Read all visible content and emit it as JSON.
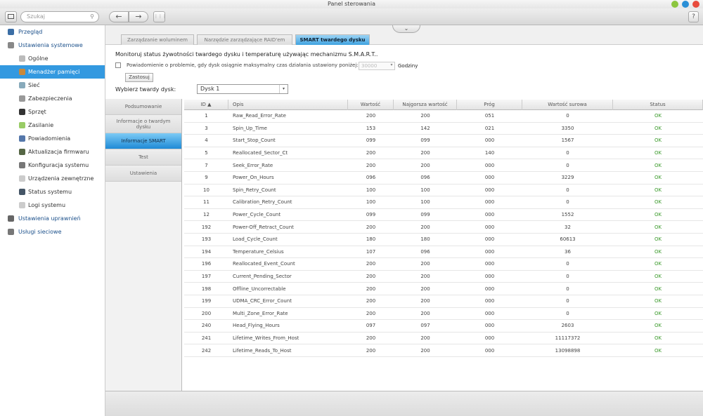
{
  "window": {
    "title": "Panel sterowania",
    "colors": {
      "minimize": "#8cc63f",
      "maximize": "#2a8fd6",
      "close": "#e84c3d"
    }
  },
  "toolbar": {
    "search_placeholder": "Szukaj",
    "back_icon": "←",
    "forward_icon": "→",
    "apps_icon": "⋮⋮⋮",
    "help_label": "?",
    "search_icon": "⚲"
  },
  "sidebar": {
    "items": [
      {
        "label": "Przegląd",
        "level": "top",
        "color": "#3b6ea5"
      },
      {
        "label": "Ustawienia systemowe",
        "level": "top",
        "color": "#888"
      },
      {
        "label": "Ogólne",
        "level": "sub",
        "color": "#bbb"
      },
      {
        "label": "Menadżer pamięci",
        "level": "sub",
        "active": true,
        "color": "#c8883a"
      },
      {
        "label": "Sieć",
        "level": "sub",
        "color": "#8ab"
      },
      {
        "label": "Zabezpieczenia",
        "level": "sub",
        "color": "#999"
      },
      {
        "label": "Sprzęt",
        "level": "sub",
        "color": "#333"
      },
      {
        "label": "Zasilanie",
        "level": "sub",
        "color": "#9c6"
      },
      {
        "label": "Powiadomienia",
        "level": "sub",
        "color": "#57a"
      },
      {
        "label": "Aktualizacja firmwaru",
        "level": "sub",
        "color": "#564"
      },
      {
        "label": "Konfiguracja systemu",
        "level": "sub",
        "color": "#777"
      },
      {
        "label": "Urządzenia zewnętrzne",
        "level": "sub",
        "color": "#ccc"
      },
      {
        "label": "Status systemu",
        "level": "sub",
        "color": "#456"
      },
      {
        "label": "Logi systemu",
        "level": "sub",
        "color": "#ccc"
      },
      {
        "label": "Ustawienia uprawnień",
        "level": "top",
        "color": "#666"
      },
      {
        "label": "Usługi sieciowe",
        "level": "top",
        "color": "#777"
      }
    ]
  },
  "tabs": [
    {
      "label": "Zarządzanie woluminem"
    },
    {
      "label": "Narzędzie zarządzające RAID'em"
    },
    {
      "label": "SMART twardego dysku",
      "active": true
    }
  ],
  "collapse_icon": "⌄",
  "main": {
    "description": "Monitoruj status żywotności twardego dysku i temperaturę używając mechanizmu S.M.A.R.T..",
    "notify_label": "Powiadomienie o problemie, gdy dysk osiągnie maksymalny czas działania ustawiony poniżej:",
    "notify_checked": false,
    "hours_value": "30000",
    "hours_unit": "Godziny",
    "apply_label": "Zastosuj",
    "disk_label": "Wybierz twardy dysk:",
    "disk_value": "Dysk 1",
    "dropdown_icon": "▾"
  },
  "subnav": [
    {
      "label": "Podsumowanie"
    },
    {
      "label": "Informacje o twardym dysku"
    },
    {
      "label": "Informacje SMART",
      "active": true
    },
    {
      "label": "Test"
    },
    {
      "label": "Ustawienia"
    }
  ],
  "table": {
    "headers": [
      "ID ▲",
      "Opis",
      "Wartość",
      "Najgorsza wartość",
      "Próg",
      "Wartość surowa",
      "Status"
    ],
    "rows": [
      [
        "1",
        "Raw_Read_Error_Rate",
        "200",
        "200",
        "051",
        "0",
        "OK"
      ],
      [
        "3",
        "Spin_Up_Time",
        "153",
        "142",
        "021",
        "3350",
        "OK"
      ],
      [
        "4",
        "Start_Stop_Count",
        "099",
        "099",
        "000",
        "1567",
        "OK"
      ],
      [
        "5",
        "Reallocated_Sector_Ct",
        "200",
        "200",
        "140",
        "0",
        "OK"
      ],
      [
        "7",
        "Seek_Error_Rate",
        "200",
        "200",
        "000",
        "0",
        "OK"
      ],
      [
        "9",
        "Power_On_Hours",
        "096",
        "096",
        "000",
        "3229",
        "OK"
      ],
      [
        "10",
        "Spin_Retry_Count",
        "100",
        "100",
        "000",
        "0",
        "OK"
      ],
      [
        "11",
        "Calibration_Retry_Count",
        "100",
        "100",
        "000",
        "0",
        "OK"
      ],
      [
        "12",
        "Power_Cycle_Count",
        "099",
        "099",
        "000",
        "1552",
        "OK"
      ],
      [
        "192",
        "Power-Off_Retract_Count",
        "200",
        "200",
        "000",
        "32",
        "OK"
      ],
      [
        "193",
        "Load_Cycle_Count",
        "180",
        "180",
        "000",
        "60613",
        "OK"
      ],
      [
        "194",
        "Temperature_Celsius",
        "107",
        "096",
        "000",
        "36",
        "OK"
      ],
      [
        "196",
        "Reallocated_Event_Count",
        "200",
        "200",
        "000",
        "0",
        "OK"
      ],
      [
        "197",
        "Current_Pending_Sector",
        "200",
        "200",
        "000",
        "0",
        "OK"
      ],
      [
        "198",
        "Offline_Uncorrectable",
        "200",
        "200",
        "000",
        "0",
        "OK"
      ],
      [
        "199",
        "UDMA_CRC_Error_Count",
        "200",
        "200",
        "000",
        "0",
        "OK"
      ],
      [
        "200",
        "Multi_Zone_Error_Rate",
        "200",
        "200",
        "000",
        "0",
        "OK"
      ],
      [
        "240",
        "Head_Flying_Hours",
        "097",
        "097",
        "000",
        "2603",
        "OK"
      ],
      [
        "241",
        "Lifetime_Writes_From_Host",
        "200",
        "200",
        "000",
        "11117372",
        "OK"
      ],
      [
        "242",
        "Lifetime_Reads_To_Host",
        "200",
        "200",
        "000",
        "13098898",
        "OK"
      ]
    ]
  }
}
